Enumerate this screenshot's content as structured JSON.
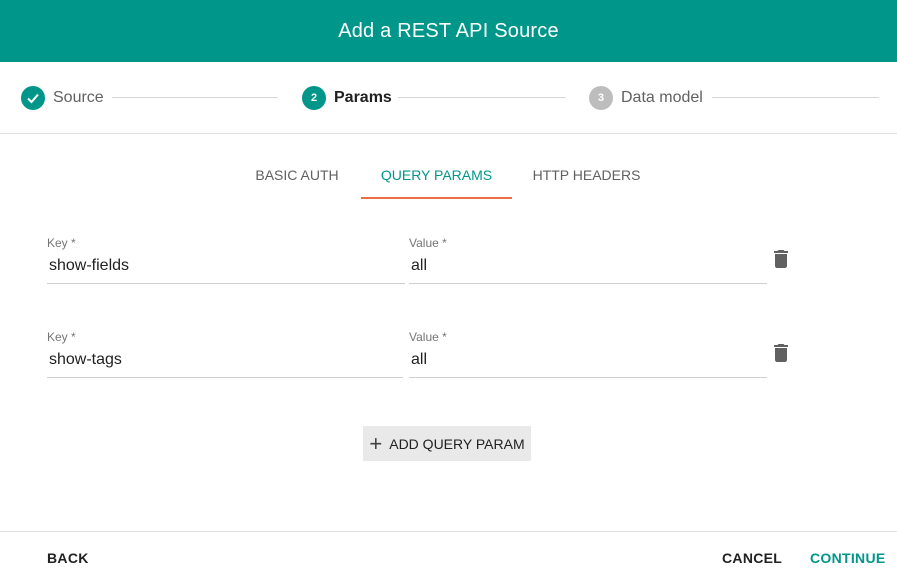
{
  "dialog": {
    "title": "Add a REST API Source"
  },
  "stepper": {
    "steps": [
      {
        "number": "",
        "label": "Source",
        "state": "completed"
      },
      {
        "number": "2",
        "label": "Params",
        "state": "active"
      },
      {
        "number": "3",
        "label": "Data model",
        "state": "upcoming"
      }
    ]
  },
  "tabs": [
    {
      "label": "BASIC AUTH"
    },
    {
      "label": "QUERY PARAMS"
    },
    {
      "label": "HTTP HEADERS"
    }
  ],
  "params": [
    {
      "key_label": "Key *",
      "key_value": "show-fields",
      "value_label": "Value *",
      "value_value": "all"
    },
    {
      "key_label": "Key *",
      "key_value": "show-tags",
      "value_label": "Value *",
      "value_value": "all"
    }
  ],
  "add_button": {
    "icon": "plus-icon",
    "label": "ADD QUERY PARAM"
  },
  "footer": {
    "back": "BACK",
    "cancel": "CANCEL",
    "continue": "CONTINUE"
  },
  "colors": {
    "primary": "#00968a",
    "tab_indicator": "#ea6f45",
    "inactive_step": "#bdbdbd"
  }
}
